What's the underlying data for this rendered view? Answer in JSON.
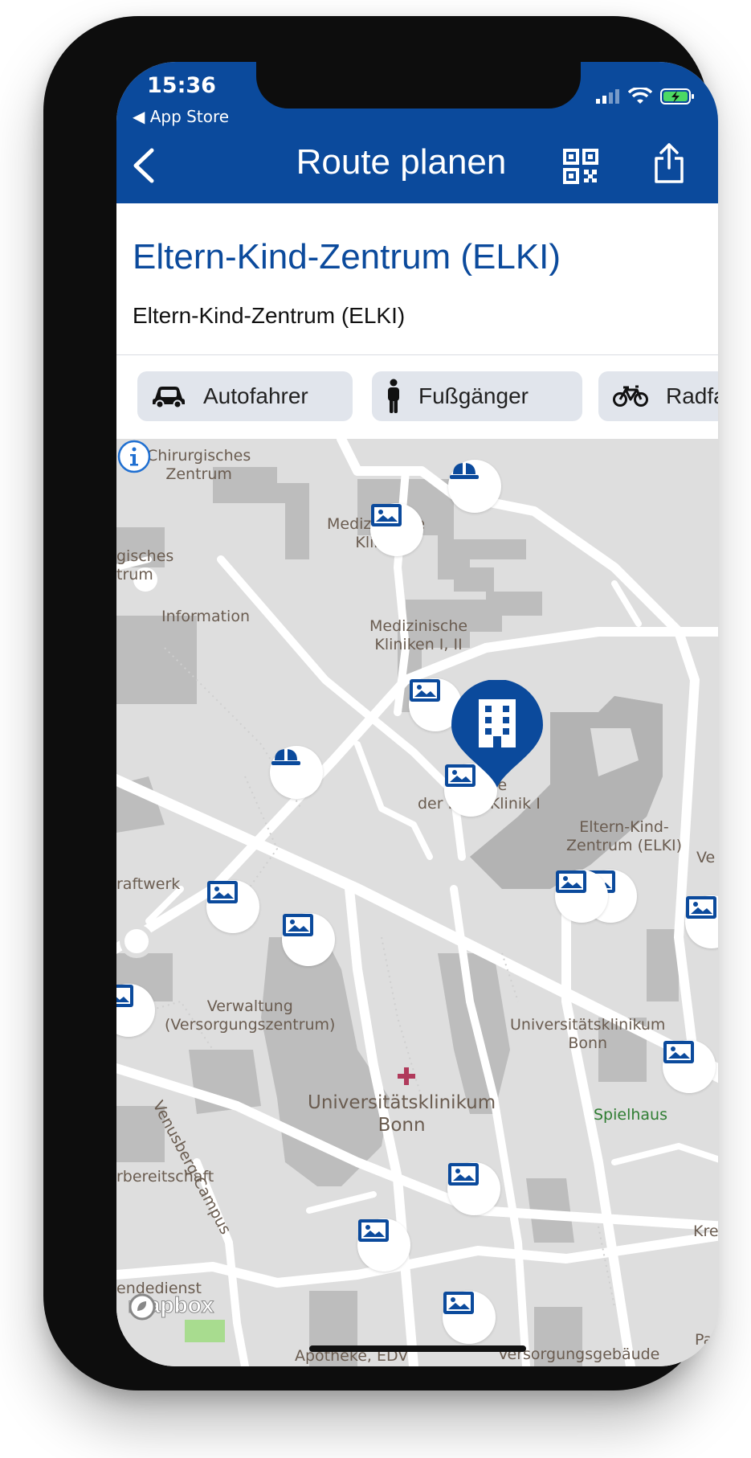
{
  "status_bar": {
    "time": "15:36",
    "back_to_app": "◀ App Store"
  },
  "header": {
    "title": "Route planen"
  },
  "place": {
    "title": "Eltern-Kind-Zentrum (ELKI)",
    "subtitle": "Eltern-Kind-Zentrum (ELKI)"
  },
  "modes": [
    {
      "label": "Autofahrer",
      "icon": "car-icon"
    },
    {
      "label": "Fußgänger",
      "icon": "pedestrian-icon"
    },
    {
      "label": "Radfa",
      "icon": "bicycle-icon"
    }
  ],
  "map": {
    "labels": {
      "chir": "Chirurgisches\nZentrum",
      "gisches": "gisches\ntrum",
      "medklinik": "Medizinische\nKlinik",
      "information": "Information",
      "medkliniken": "Medizinische\nKliniken I, II",
      "dialyse": "Dialyse\nder Med. Klinik I",
      "elki": "Eltern-Kind-\nZentrum (ELKI)",
      "ve": "Ve",
      "kraftwerk": "raftwerk",
      "verwaltung": "Verwaltung\n(Versorgungszentrum)",
      "uk_small": "Universitätsklinikum\nBonn",
      "venusberg": "Venusberg-Campus",
      "uk_big": "Universitätsklinikum\nBonn",
      "spielhaus": "Spielhaus",
      "bereitschaft": "rbereitschaft",
      "kre": "Kre",
      "dienst": "endedienst",
      "apotheke": "Apotheke, EDV",
      "versorgung": "Versorgungsgebäude",
      "pa": "Pa"
    },
    "attribution": "mapbox",
    "colors": {
      "primary": "#0b4a9c",
      "map_bg": "#dedede",
      "building": "#bdbdbd",
      "road": "#ffffff"
    }
  }
}
